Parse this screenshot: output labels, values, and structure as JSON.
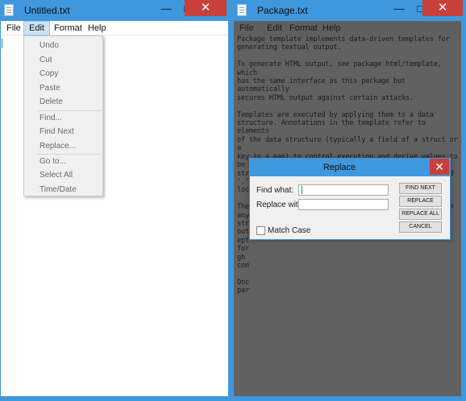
{
  "left_window": {
    "title": "Untitled.txt",
    "controls": {
      "minimize": "—",
      "maximize": "□",
      "close": "✕"
    },
    "menu": [
      "File",
      "Edit",
      "Format",
      "Help"
    ],
    "active_menu": "Edit",
    "edit_menu_items": [
      "Undo",
      "Cut",
      "Copy",
      "Paste",
      "Delete",
      "Find...",
      "Find Next",
      "Replace...",
      "Go to...",
      "Select All",
      "Time/Date"
    ]
  },
  "right_window": {
    "title": "Package.txt",
    "controls": {
      "minimize": "—",
      "maximize": "□",
      "close": "✕"
    },
    "menu": [
      "File",
      "Edit",
      "Format",
      "Help"
    ],
    "document_text": "Package template implements data-driven templates for\ngenerating textual output.\n\nTo generate HTML output, see package html/template, which\nhas the same interface as this package but automatically\nsecures HTML output against certain attacks.\n\nTemplates are executed by applying them to a data\nstructure. Annotations in the template refer to elements\nof the data structure (typically a field of a struct or a\nkey in a map) to control execution and derive values to\nbe displayed. Execution of the template walks the\nstructure and sets the cursor, represented by a period\n'.' and called \"dot\", to the value at the current\nlocation in the structure as execution proceeds.\n\nThe input text for a template is UTF-8-encoded text in\nany format. \"Actions\"--data evaluations or control\nstr\nout                                                   ept\nfor                                                   gh\ncom\n\nOnc\npar"
  },
  "replace_dialog": {
    "title": "Replace",
    "close": "✕",
    "find_label": "Find what:",
    "find_value": "",
    "replace_label": "Replace with:",
    "replace_value": "",
    "buttons": [
      "FIND NEXT",
      "REPLACE",
      "REPLACE ALL",
      "CANCEL"
    ],
    "match_case_label": "Match Case",
    "match_case_checked": false
  }
}
